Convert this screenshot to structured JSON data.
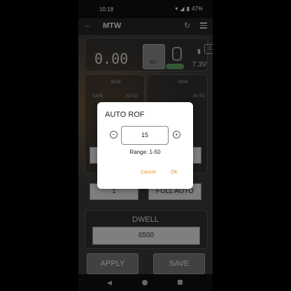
{
  "status": {
    "time": "10:18",
    "battery": "47%"
  },
  "appbar": {
    "title": "MTW"
  },
  "top_panel": {
    "readout": "0.00",
    "gauge_unit": "ft/s",
    "battery_badge": "1",
    "voltage": "7.3V"
  },
  "mode_left": {
    "semi": "SEMI",
    "safe": "SAFE",
    "auto": "AUTO"
  },
  "mode_right": {
    "semi": "SEMI",
    "auto": "AUTO"
  },
  "fields": {
    "burst": "1",
    "full_auto": "FULL AUTO"
  },
  "dwell": {
    "title": "DWELL",
    "value": "6500"
  },
  "buttons": {
    "apply": "APPLY",
    "save": "SAVE"
  },
  "dialog": {
    "title": "AUTO ROF",
    "value": "15",
    "range": "Range: 1-50",
    "cancel": "Cancel",
    "ok": "OK"
  },
  "colors": {
    "accent": "#e8901a",
    "toggle": "#5fa05f"
  }
}
